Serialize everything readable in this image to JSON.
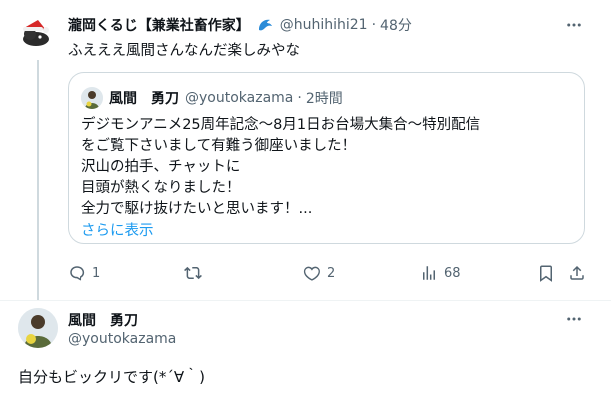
{
  "post1": {
    "author_name": "瀧岡くるじ【兼業社畜作家】",
    "badge_icon": "blue-dolphin-icon",
    "handle": "@huhihihi21",
    "time": "48分",
    "text": "ふえええ風間さんなんだ楽しみやな",
    "quote": {
      "author_name": "風間　勇刀",
      "handle": "@youtokazama",
      "time": "2時間",
      "lines": [
        "デジモンアニメ25周年記念〜8月1日お台場大集合〜特別配信",
        "をご覧下さいまして有難う御座いました！",
        "沢山の拍手、チャットに",
        "目頭が熱くなりました！",
        "全力で駆け抜けたいと思います！..."
      ],
      "show_more": "さらに表示"
    },
    "actions": {
      "reply": {
        "icon": "reply-icon",
        "count": "1"
      },
      "repost": {
        "icon": "repost-icon",
        "count": ""
      },
      "like": {
        "icon": "heart-icon",
        "count": "2"
      },
      "views": {
        "icon": "analytics-icon",
        "count": "68"
      },
      "bookmark": {
        "icon": "bookmark-icon"
      },
      "share": {
        "icon": "share-icon"
      }
    }
  },
  "post2": {
    "author_name": "風間　勇刀",
    "handle": "@youtokazama",
    "text": "自分もビックリです(*´∀｀)"
  },
  "colors": {
    "text_primary": "#0f1419",
    "text_secondary": "#536471",
    "accent_blue": "#1d9bf0",
    "border": "#cfd9de"
  }
}
